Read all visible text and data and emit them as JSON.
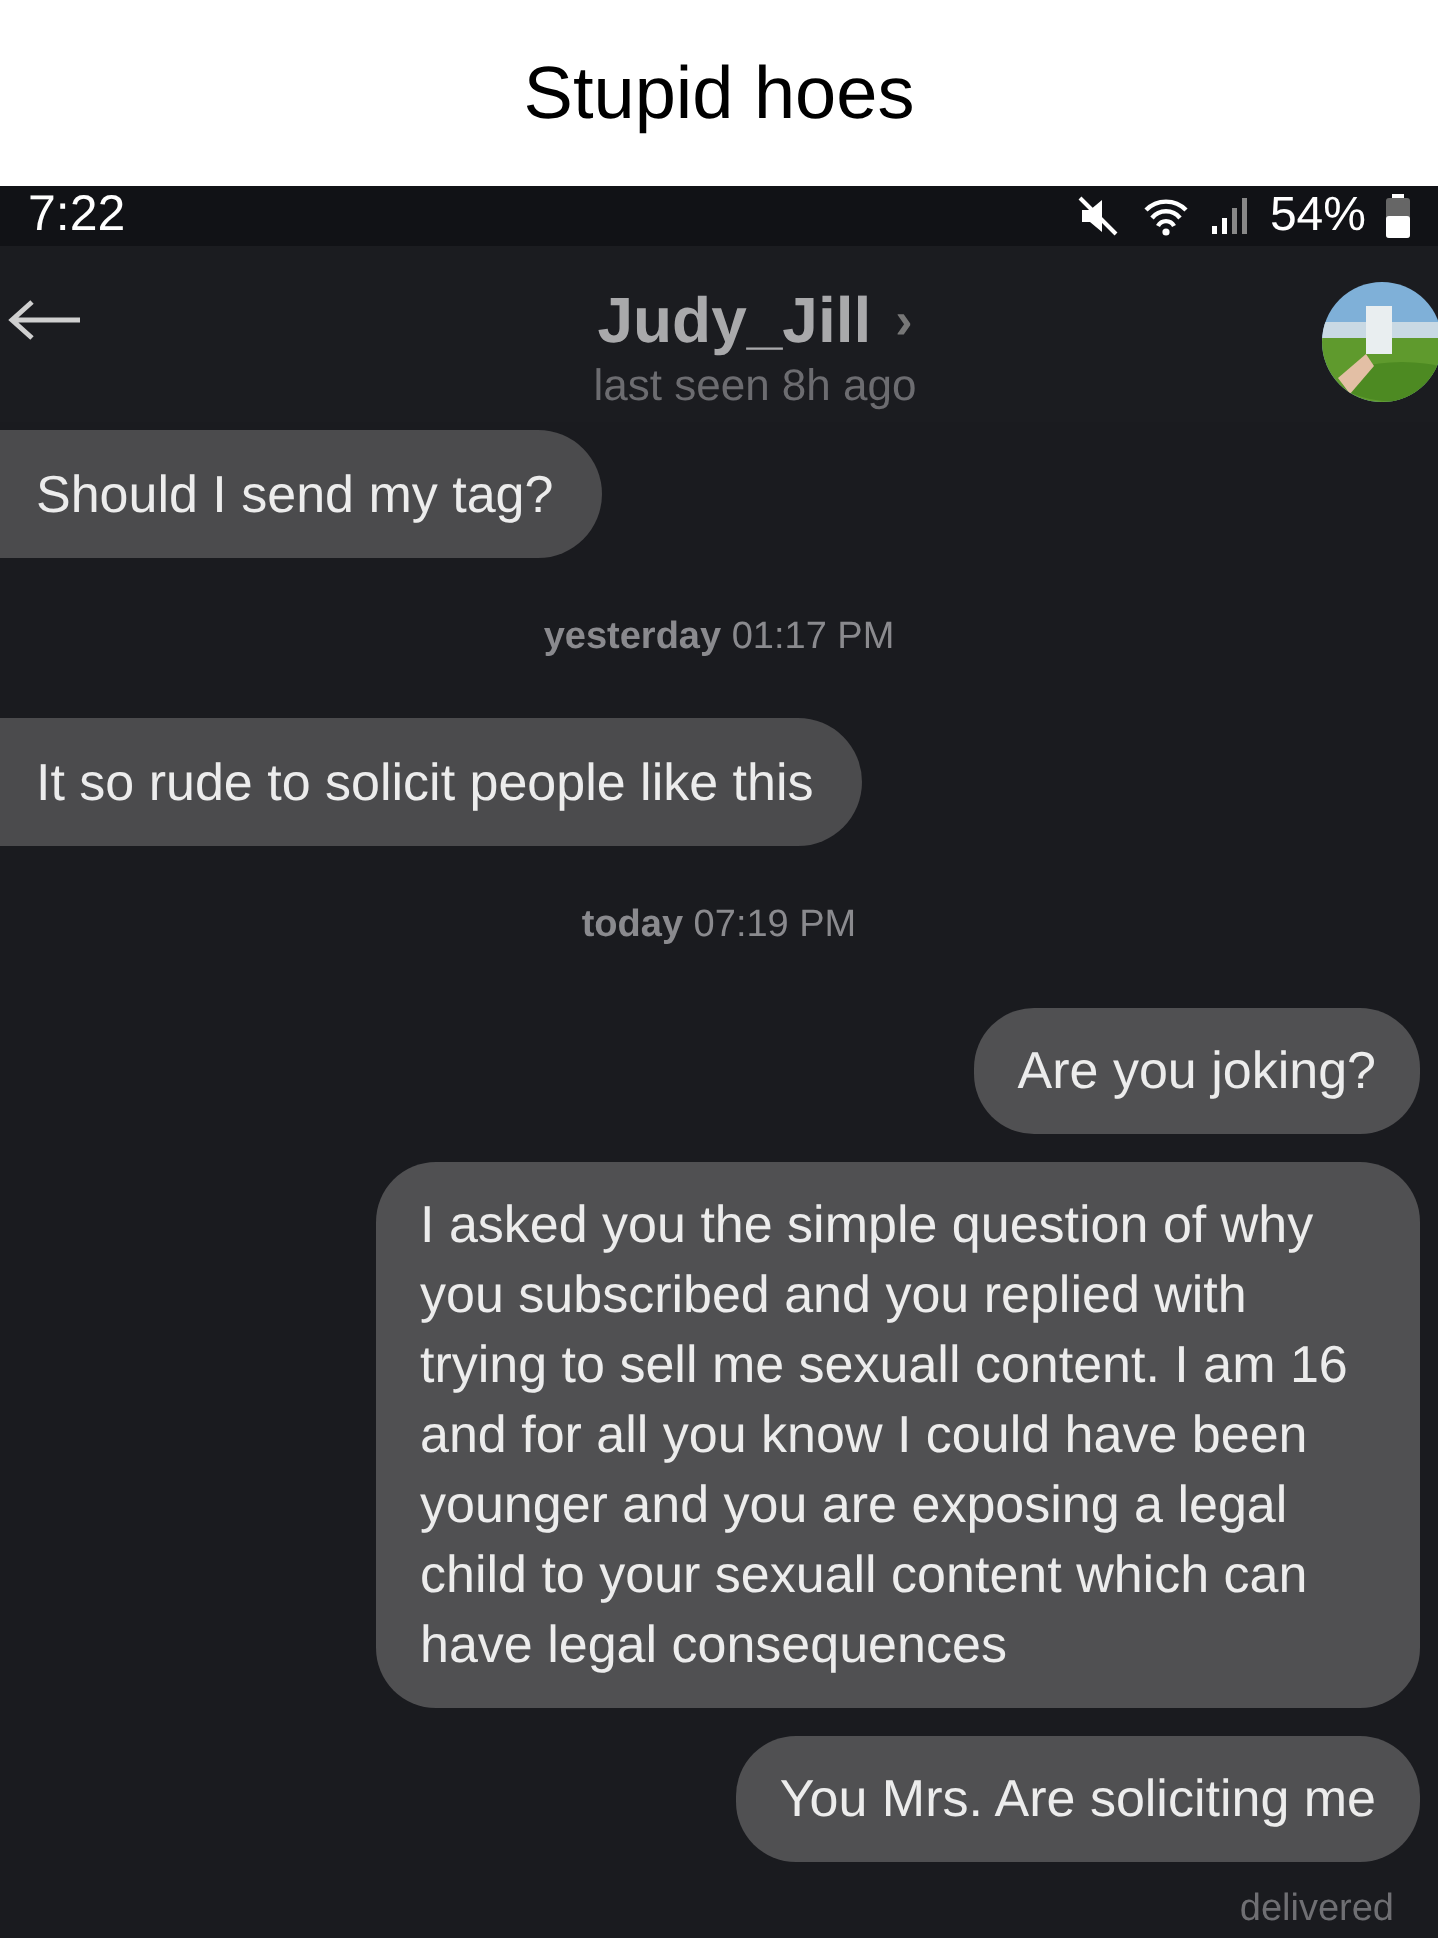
{
  "caption": "Stupid hoes",
  "status_bar": {
    "time": "7:22",
    "battery": "54%"
  },
  "header": {
    "name": "Judy_Jill",
    "chevron": "›",
    "subtitle": "last seen 8h ago"
  },
  "messages": [
    {
      "kind": "incoming",
      "text": "Should I send my tag?"
    },
    {
      "kind": "timestamp",
      "text": "**yesterday** 01:17 PM"
    },
    {
      "kind": "incoming",
      "text": "It so rude to solicit people like this"
    },
    {
      "kind": "timestamp",
      "text": "**today** 07:19 PM"
    },
    {
      "kind": "outgoing",
      "text": "Are you joking?"
    },
    {
      "kind": "outgoing",
      "text": "I asked you the simple question of why you subscribed and you replied with trying to sell me sexuall content. I am 16 and for all you know I could have been younger and you are exposing a legal child to your sexuall content which can have legal consequences"
    },
    {
      "kind": "outgoing",
      "text": "You Mrs. Are soliciting me"
    },
    {
      "kind": "receipt",
      "text": "delivered"
    }
  ]
}
